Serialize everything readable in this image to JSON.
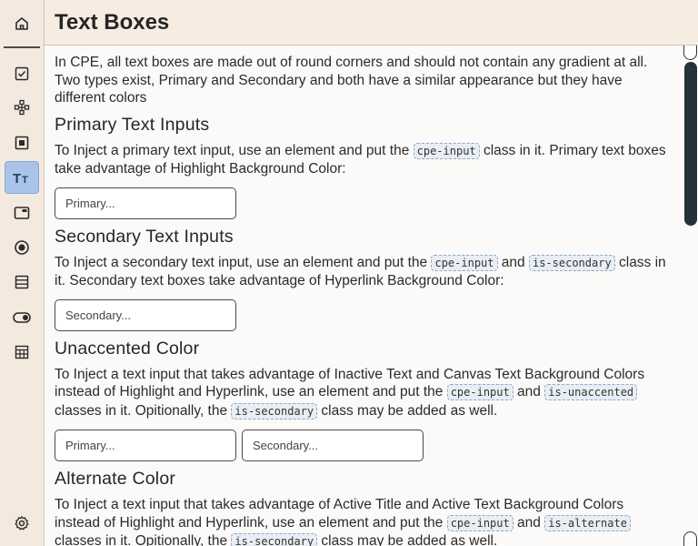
{
  "header": {
    "title": "Text Boxes"
  },
  "intro": "In CPE, all text boxes are made out of round corners and should not contain any gradient at all. Two types exist, Primary and Secondary and both have a similar appearance but they have different colors",
  "sections": {
    "primary": {
      "heading": "Primary Text Inputs",
      "text_a": "To Inject a primary text input, use an element and put the ",
      "code_1": "cpe-input",
      "text_b": " class in it. Primary text boxes take advantage of Highlight Background Color:",
      "placeholder": "Primary..."
    },
    "secondary": {
      "heading": "Secondary Text Inputs",
      "text_a": "To Inject a secondary text input, use an element and put the ",
      "code_1": "cpe-input",
      "text_b": " and ",
      "code_2": "is-secondary",
      "text_c": " class in it. Secondary text boxes take advantage of Hyperlink Background Color:",
      "placeholder": "Secondary..."
    },
    "unaccented": {
      "heading": "Unaccented Color",
      "text_a": "To Inject a text input that takes advantage of Inactive Text and Canvas Text Background Colors instead of Highlight and Hyperlink, use an element and put the ",
      "code_1": "cpe-input",
      "text_b": " and ",
      "code_2": "is-unaccented",
      "text_c": " classes in it. Opitionally, the ",
      "code_3": "is-secondary",
      "text_d": " class may be added as well.",
      "placeholder_primary": "Primary...",
      "placeholder_secondary": "Secondary..."
    },
    "alternate": {
      "heading": "Alternate Color",
      "text_a": "To Inject a text input that takes advantage of Active Title and Active Text Background Colors instead of Highlight and Hyperlink, use an element and put the ",
      "code_1": "cpe-input",
      "text_b": " and ",
      "code_2": "is-alternate",
      "text_c": " classes in it. Opitionally, the ",
      "code_3": "is-secondary",
      "text_d": " class may be added as well."
    }
  },
  "sidebar": {
    "items": [
      {
        "icon": "home-icon"
      },
      {
        "icon": "checkbox-icon"
      },
      {
        "icon": "network-icon"
      },
      {
        "icon": "square-icon"
      },
      {
        "icon": "text-icon",
        "active": true
      },
      {
        "icon": "window-icon"
      },
      {
        "icon": "radio-icon"
      },
      {
        "icon": "list-icon"
      },
      {
        "icon": "toggle-icon"
      },
      {
        "icon": "table-icon"
      },
      {
        "icon": "gear-icon"
      }
    ]
  },
  "colors": {
    "sidebar_bg": "#f4e9df",
    "content_bg": "#fcfaf8",
    "active_item": "#a9c4e8",
    "code_bg": "#e8eef3",
    "scroll_thumb": "#263238"
  }
}
